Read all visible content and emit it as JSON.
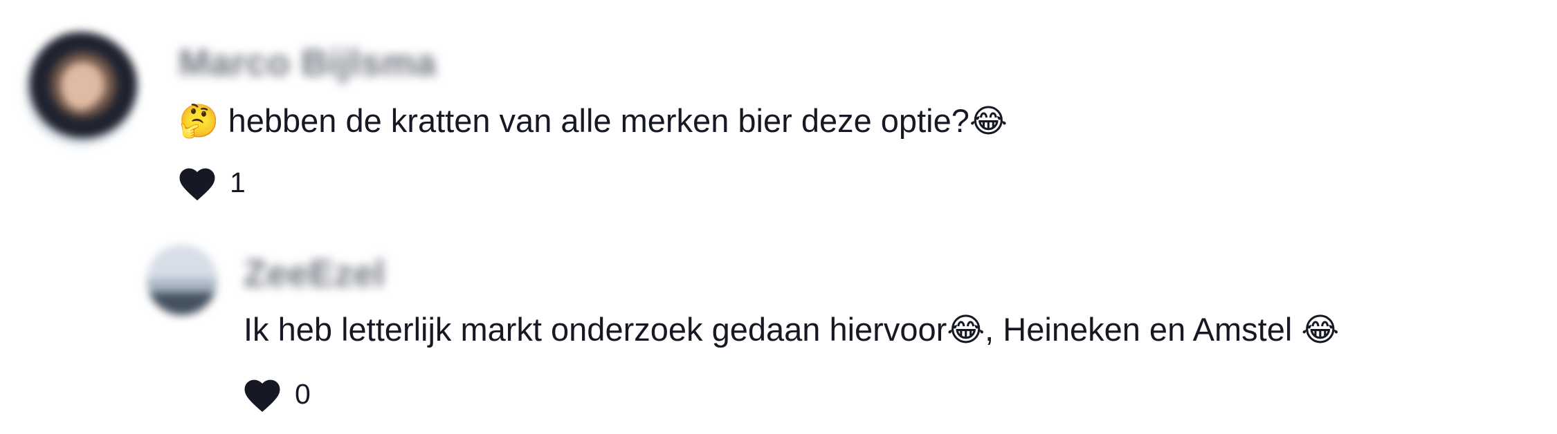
{
  "comments": [
    {
      "username": "Marco Bijlsma",
      "text": "🤔 hebben de kratten van alle merken bier deze optie?😂",
      "like_count": "1"
    }
  ],
  "reply": {
    "username": "ZeeEzel",
    "text": "Ik heb letterlijk markt onderzoek gedaan hiervoor😂, Heineken en Amstel 😂",
    "like_count": "0"
  },
  "icons": {
    "like": "heart-icon"
  },
  "colors": {
    "text": "#161823",
    "username": "#6f7480",
    "background": "#ffffff"
  }
}
